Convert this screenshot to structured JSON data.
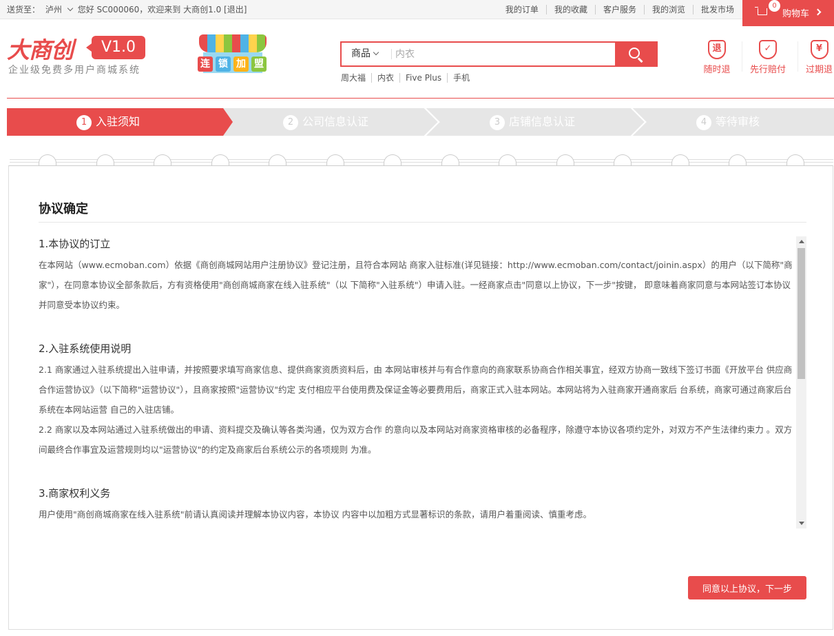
{
  "topbar": {
    "ship_to_label": "送货至：",
    "city": "泸州",
    "welcome": "您好 SC000060，欢迎来到 大商创1.0 [退出]",
    "links": [
      "我的订单",
      "我的收藏",
      "客户服务",
      "我的浏览",
      "批发市场"
    ],
    "cart_count": "0",
    "cart_label": "购物车"
  },
  "header": {
    "logo_name": "大商创",
    "logo_version": "V1.0",
    "slogan": "企业级免费多用户商城系统",
    "franchise_words": [
      "连",
      "锁",
      "加",
      "盟"
    ],
    "search_category": "商品",
    "search_placeholder": "内衣",
    "hot_keywords": [
      "周大福",
      "内衣",
      "Five Plus",
      "手机"
    ],
    "promises": [
      {
        "icon_char": "退",
        "label": "随时退"
      },
      {
        "icon_char": "✓",
        "label": "先行赔付"
      },
      {
        "icon_char": "¥",
        "label": "过期退"
      }
    ]
  },
  "steps": [
    {
      "num": "1",
      "label": "入驻须知"
    },
    {
      "num": "2",
      "label": "公司信息认证"
    },
    {
      "num": "3",
      "label": "店铺信息认证"
    },
    {
      "num": "4",
      "label": "等待审核"
    }
  ],
  "panel": {
    "title": "协议确定",
    "sections": [
      {
        "heading": "1.本协议的订立",
        "paras": [
          "在本网站（www.ecmoban.com）依据《商创商城网站用户注册协议》登记注册，且符合本网站 商家入驻标准(详见链接：http://www.ecmoban.com/contact/joinin.aspx）的用户（以下简称\"商 家\"），在同意本协议全部条款后，方有资格使用\"商创商城商家在线入驻系统\"（以 下简称\"入驻系统\"）申请入驻。一经商家点击\"同意以上协议，下一步\"按键， 即意味着商家同意与本网站签订本协议并同意受本协议约束。"
        ]
      },
      {
        "heading": "2.入驻系统使用说明",
        "paras": [
          "2.1 商家通过入驻系统提出入驻申请，并按照要求填写商家信息、提供商家资质资料后，由 本网站审核并与有合作意向的商家联系协商合作相关事宜，经双方协商一致线下签订书面《开放平台 供应商合作运营协议》（以下简称\"运营协议\"），且商家按照\"运营协议\"约定 支付相应平台使用费及保证金等必要费用后，商家正式入驻本网站。本网站将为入驻商家开通商家后 台系统，商家可通过商家后台系统在本网站运营 自己的入驻店铺。",
          "2.2 商家以及本网站通过入驻系统做出的申请、资料提交及确认等各类沟通，仅为双方合作 的意向以及本网站对商家资格审核的必备程序，除遵守本协议各项约定外，对双方不产生法律约束力 。双方间最终合作事宜及运营规则均以\"运营协议\"的约定及商家后台系统公示的各项规则 为准。"
        ]
      },
      {
        "heading": "3.商家权利义务",
        "paras": [
          "用户使用\"商创商城商家在线入驻系统\"前请认真阅读并理解本协议内容，本协议 内容中以加粗方式显著标识的条款，请用户着重阅读、慎重考虑。"
        ]
      }
    ],
    "next_button": "同意以上协议，下一步"
  },
  "colors": {
    "accent": "#e84c4c",
    "step_inactive": "#e6e6e6"
  }
}
